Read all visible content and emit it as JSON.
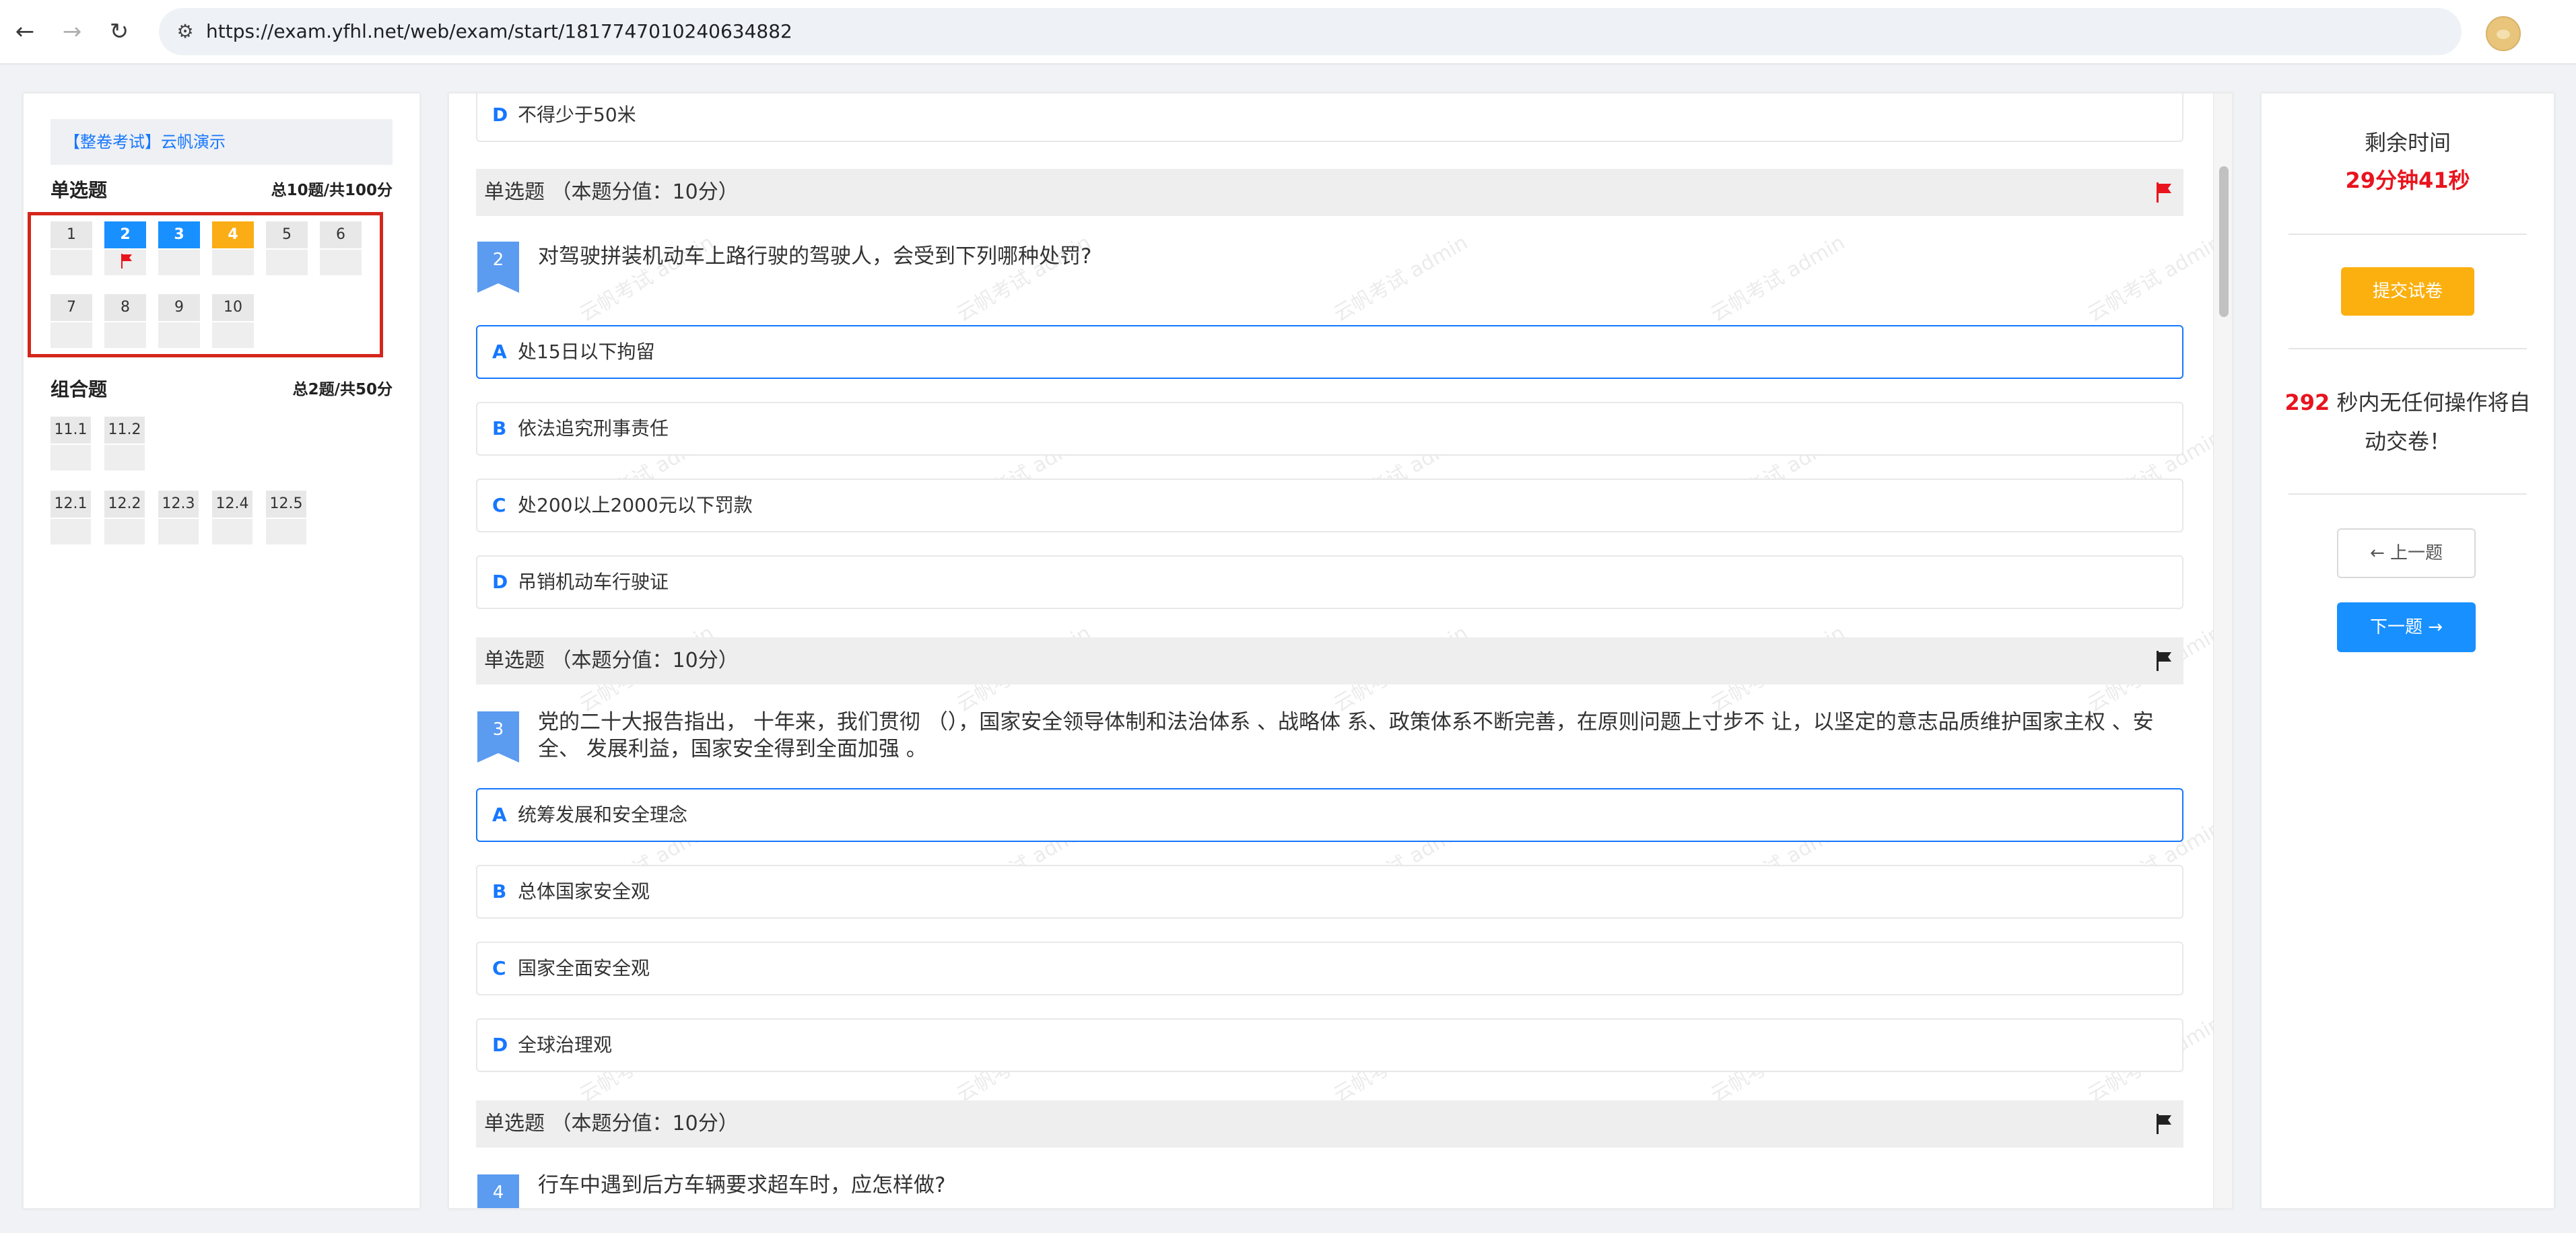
{
  "browser": {
    "back_icon": "←",
    "forward_icon": "→",
    "reload_icon": "↻",
    "site_info_icon": "⚙",
    "url": "https://exam.yfhl.net/web/exam/start/1817747010240634882",
    "star_icon": "☆"
  },
  "left": {
    "exam_title": "【整卷考试】云帆演示",
    "single_section": {
      "title": "单选题",
      "summary": "总10题/共100分"
    },
    "single_numbers": [
      {
        "label": "1",
        "state": "normal"
      },
      {
        "label": "2",
        "state": "blue",
        "flagged": true
      },
      {
        "label": "3",
        "state": "blue"
      },
      {
        "label": "4",
        "state": "orange"
      },
      {
        "label": "5",
        "state": "normal"
      },
      {
        "label": "6",
        "state": "normal"
      },
      {
        "label": "7",
        "state": "normal"
      },
      {
        "label": "8",
        "state": "normal"
      },
      {
        "label": "9",
        "state": "normal"
      },
      {
        "label": "10",
        "state": "normal"
      }
    ],
    "combo_section": {
      "title": "组合题",
      "summary": "总2题/共50分"
    },
    "combo_row1": [
      "11.1",
      "11.2"
    ],
    "combo_row2": [
      "12.1",
      "12.2",
      "12.3",
      "12.4",
      "12.5"
    ]
  },
  "center": {
    "watermark": "云帆考试 admin",
    "prev_option": {
      "letter": "D",
      "text": "不得少于50米"
    },
    "questions": [
      {
        "header": "单选题 （本题分值：10分）",
        "flag_color": "#e8141e",
        "number": "2",
        "stem": "对驾驶拼装机动车上路行驶的驾驶人，会受到下列哪种处罚?",
        "options": [
          {
            "letter": "A",
            "text": "处15日以下拘留",
            "selected": true
          },
          {
            "letter": "B",
            "text": "依法追究刑事责任"
          },
          {
            "letter": "C",
            "text": "处200以上2000元以下罚款"
          },
          {
            "letter": "D",
            "text": "吊销机动车行驶证"
          }
        ]
      },
      {
        "header": "单选题 （本题分值：10分）",
        "flag_color": "#222222",
        "number": "3",
        "stem": "党的二十大报告指出， 十年来，我们贯彻 （），国家安全领导体制和法治体系 、战略体 系、政策体系不断完善，在原则问题上寸步不 让，以坚定的意志品质维护国家主权 、安全、 发展利益，国家安全得到全面加强 。",
        "options": [
          {
            "letter": "A",
            "text": "统筹发展和安全理念",
            "selected": true
          },
          {
            "letter": "B",
            "text": "总体国家安全观"
          },
          {
            "letter": "C",
            "text": "国家全面安全观"
          },
          {
            "letter": "D",
            "text": "全球治理观"
          }
        ]
      },
      {
        "header": "单选题 （本题分值：10分）",
        "flag_color": "#222222",
        "number": "4",
        "stem": "行车中遇到后方车辆要求超车时，应怎样做?"
      }
    ]
  },
  "right": {
    "time_label": "剩余时间",
    "time_value": "29分钟41秒",
    "submit_label": "提交试卷",
    "idle_seconds": "292",
    "idle_text": " 秒内无任何操作将自动交卷！",
    "prev_label": "← 上一题",
    "next_label": "下一题 →",
    "accent_color": "#1890ff",
    "warn_color": "#e8141e",
    "submit_color": "#fbb00f"
  }
}
